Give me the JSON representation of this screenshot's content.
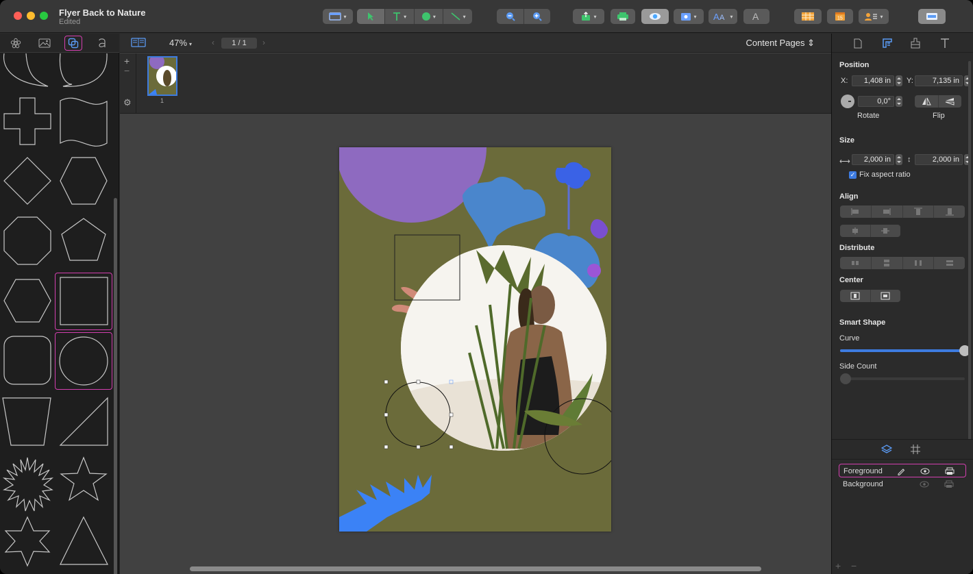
{
  "window": {
    "title": "Flyer Back to Nature",
    "subtitle": "Edited"
  },
  "canvas": {
    "zoom": "47%",
    "page_field": "1 / 1",
    "view_mode": "Content Pages",
    "thumb_number": "1"
  },
  "inspector": {
    "position_title": "Position",
    "x_label": "X:",
    "x_value": "1,408 in",
    "y_label": "Y:",
    "y_value": "7,135 in",
    "rotate_value": "0,0°",
    "rotate_label": "Rotate",
    "flip_label": "Flip",
    "size_title": "Size",
    "width_value": "2,000 in",
    "height_value": "2,000 in",
    "fix_aspect_label": "Fix aspect ratio",
    "align_title": "Align",
    "distribute_title": "Distribute",
    "center_title": "Center",
    "smart_shape_title": "Smart Shape",
    "curve_label": "Curve",
    "side_count_label": "Side Count",
    "curve_level": 1.0,
    "side_count_level": 0.0
  },
  "layers": [
    {
      "name": "Foreground"
    },
    {
      "name": "Background"
    }
  ],
  "colors": {
    "accent": "#3d7be0",
    "selection": "#d43fb0",
    "page_bg": "#6b6b3a",
    "purple": "#8e6ac0",
    "blue": "#3b82f6",
    "pink": "#d08a78"
  }
}
